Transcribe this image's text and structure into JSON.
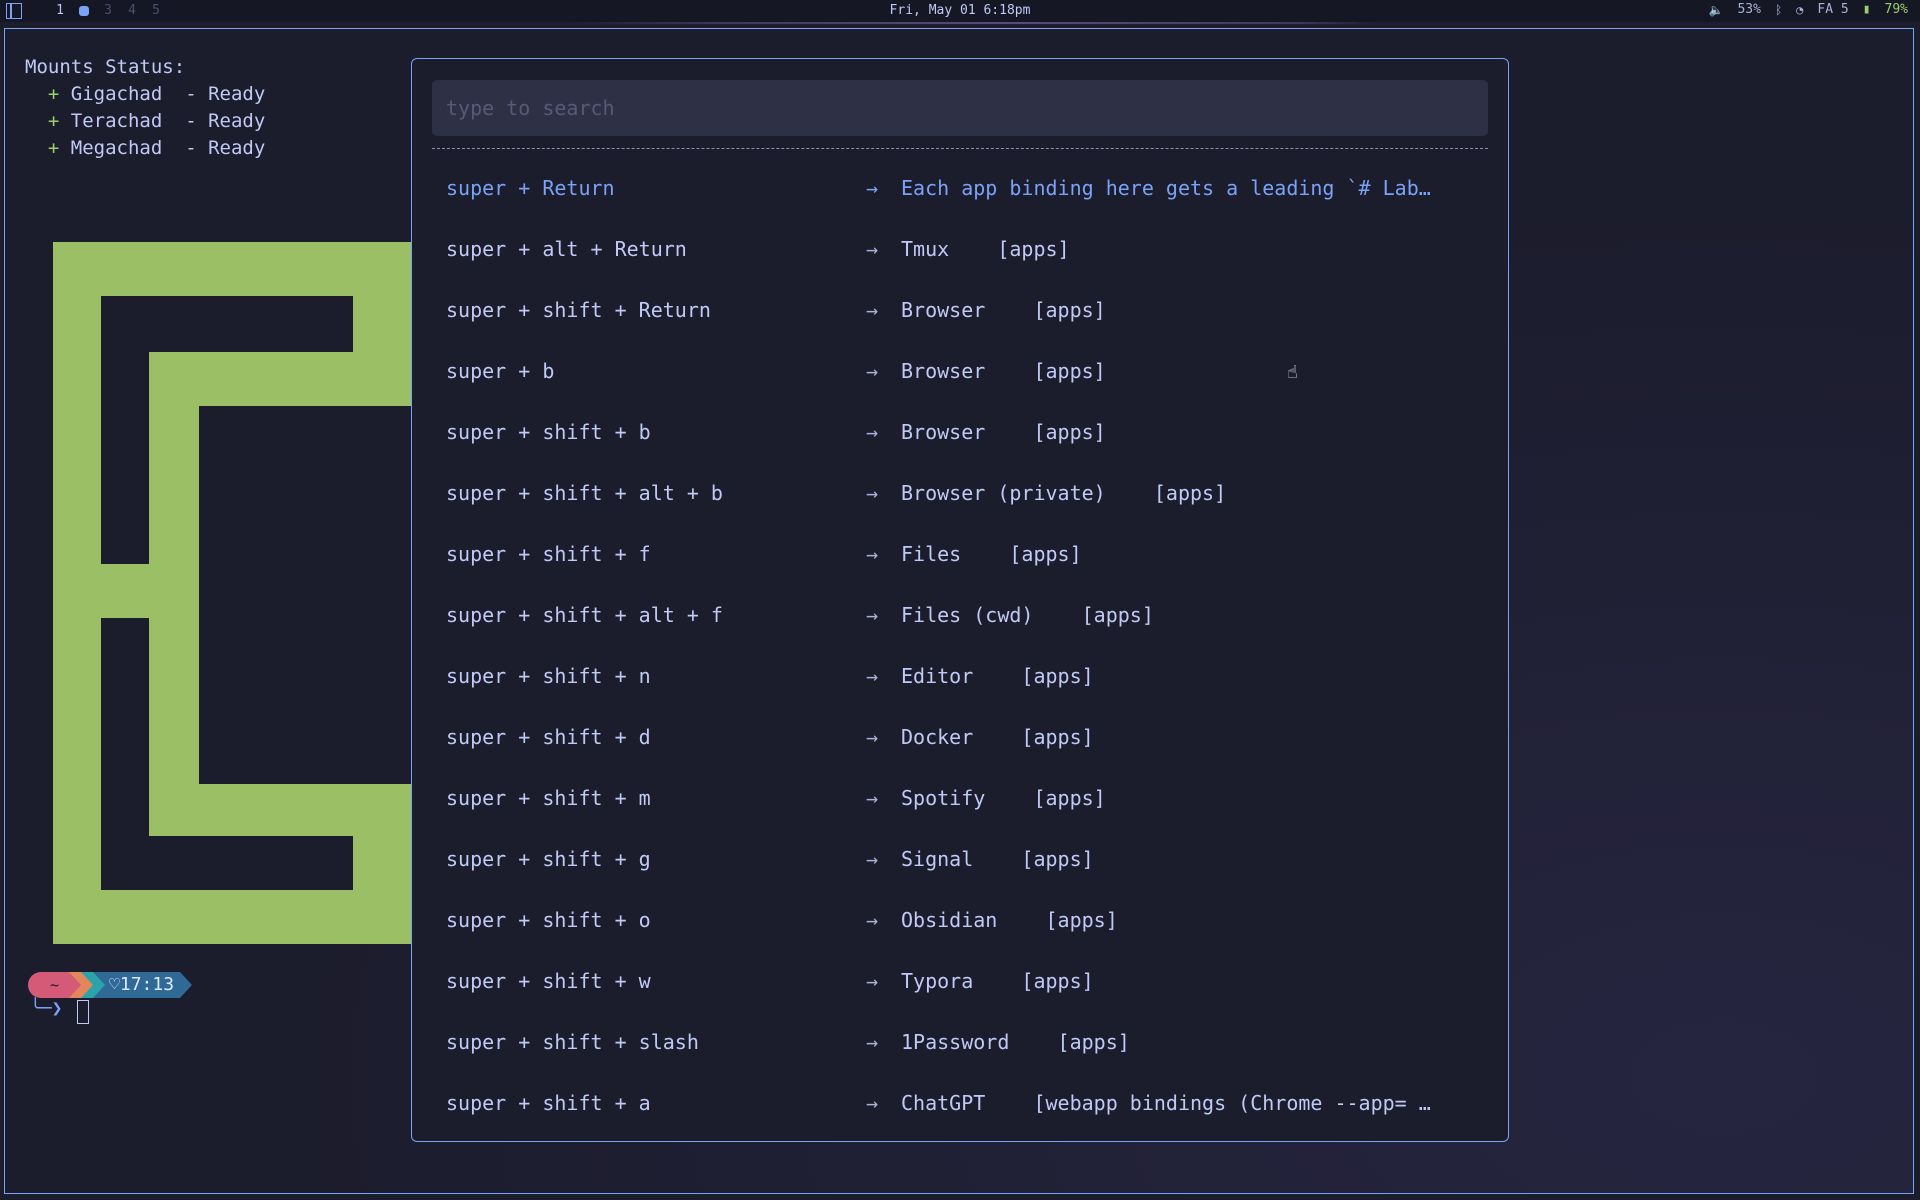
{
  "topbar": {
    "workspaces": [
      "1",
      "",
      "3",
      "4",
      "5"
    ],
    "datetime": "Fri, May 01 6:18pm",
    "volume": "53%",
    "keyboard": "FA 5",
    "battery": "79%"
  },
  "terminal": {
    "mounts_title": "Mounts Status:",
    "mounts": [
      {
        "marker": "+",
        "name": "Gigachad",
        "status": "- Ready"
      },
      {
        "marker": "+",
        "name": "Terachad",
        "status": "- Ready"
      },
      {
        "marker": "+",
        "name": "Megachad",
        "status": "- Ready"
      }
    ],
    "prompt": {
      "dir": "~",
      "time": "17:13"
    },
    "logo_color": "#9bbf65"
  },
  "launcher": {
    "placeholder": "type to search",
    "search_value": "",
    "arrow": "→",
    "rows": [
      {
        "keys": "super + Return",
        "action": "Each app binding here gets a leading `# Lab…",
        "selected": true
      },
      {
        "keys": "super + alt + Return",
        "action": "Tmux    [apps]"
      },
      {
        "keys": "super + shift + Return",
        "action": "Browser    [apps]"
      },
      {
        "keys": "super + b",
        "action": "Browser    [apps]"
      },
      {
        "keys": "super + shift + b",
        "action": "Browser    [apps]"
      },
      {
        "keys": "super + shift + alt + b",
        "action": "Browser (private)    [apps]"
      },
      {
        "keys": "super + shift + f",
        "action": "Files    [apps]"
      },
      {
        "keys": "super + shift + alt + f",
        "action": "Files (cwd)    [apps]"
      },
      {
        "keys": "super + shift + n",
        "action": "Editor    [apps]"
      },
      {
        "keys": "super + shift + d",
        "action": "Docker    [apps]"
      },
      {
        "keys": "super + shift + m",
        "action": "Spotify    [apps]"
      },
      {
        "keys": "super + shift + g",
        "action": "Signal    [apps]"
      },
      {
        "keys": "super + shift + o",
        "action": "Obsidian    [apps]"
      },
      {
        "keys": "super + shift + w",
        "action": "Typora    [apps]"
      },
      {
        "keys": "super + shift + slash",
        "action": "1Password    [apps]"
      },
      {
        "keys": "super + shift + a",
        "action": "ChatGPT    [webapp bindings (Chrome --app= …"
      }
    ]
  },
  "colors": {
    "accent": "#7aa2f7",
    "background": "#1b1c2c",
    "green": "#9ece6a"
  }
}
